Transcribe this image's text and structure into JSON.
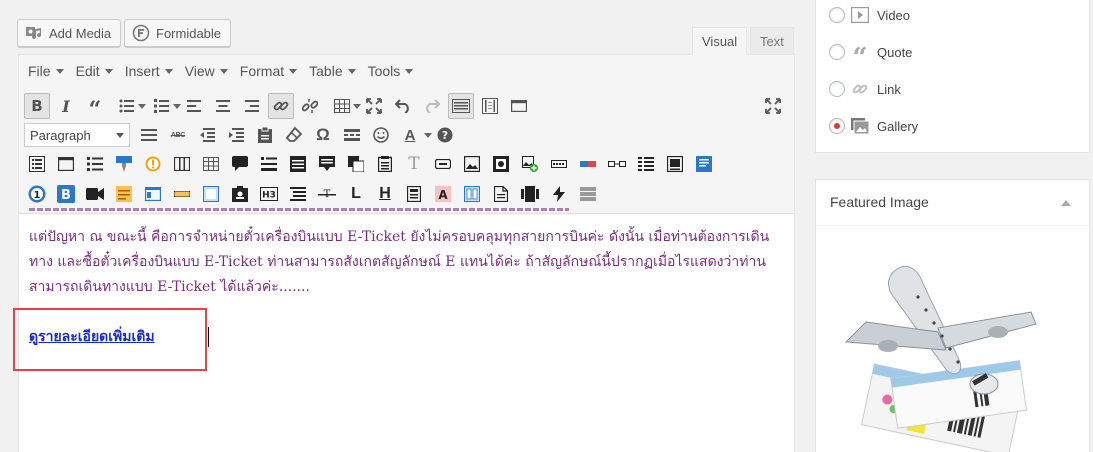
{
  "media_buttons": {
    "add_media": "Add Media",
    "formidable": "Formidable"
  },
  "editor_tabs": {
    "visual": "Visual",
    "text": "Text"
  },
  "menubar": [
    "File",
    "Edit",
    "Insert",
    "View",
    "Format",
    "Table",
    "Tools"
  ],
  "format_select": {
    "value": "Paragraph"
  },
  "content": {
    "paragraph": "แต่ปัญหา ณ ขณะนี้ คือการจำหน่ายตั๋วเครื่องบินแบบ E-Ticket ยังไม่ครอบคลุมทุกสายการบินค่ะ ดังนั้น เมื่อท่านต้องการเดินทาง และซื้อตั๋วเครื่องบินแบบ E-Ticket ท่านสามารถสังเกตสัญลักษณ์ E แทนได้ค่ะ ถ้าสัญลักษณ์นี้ปรากฏเมื่อไรแสดงว่าท่านสามารถเดินทางแบบ E-Ticket ได้แล้วค่ะ.......",
    "more_link": "ดูรายละเอียดเพิ่มเติม"
  },
  "post_formats": [
    {
      "label": "Video",
      "icon": "video-icon",
      "selected": false
    },
    {
      "label": "Quote",
      "icon": "quote-icon",
      "selected": false
    },
    {
      "label": "Link",
      "icon": "link-icon",
      "selected": false
    },
    {
      "label": "Gallery",
      "icon": "gallery-icon",
      "selected": true
    }
  ],
  "featured_image": {
    "title": "Featured Image"
  },
  "colors": {
    "content_text": "#7a2e7d",
    "link": "#1a2bc8",
    "highlight": "#e04646",
    "selected_radio": "#dd3d36"
  }
}
